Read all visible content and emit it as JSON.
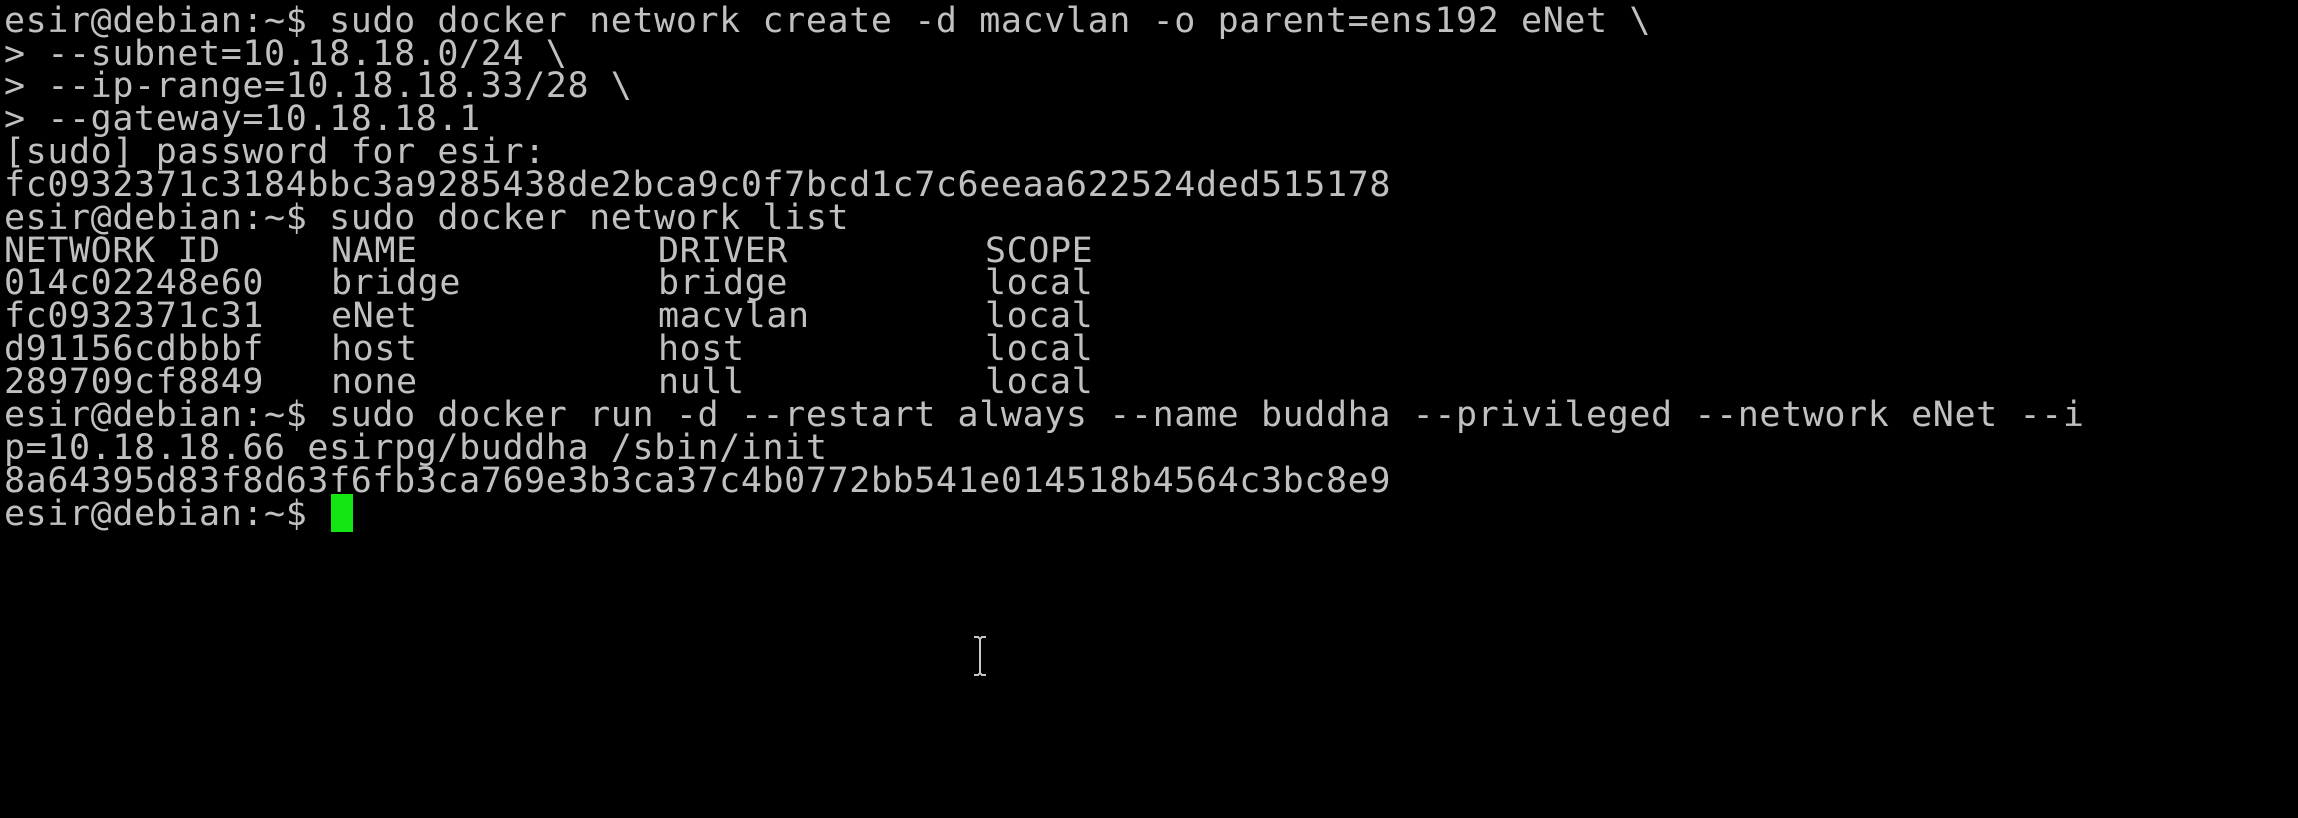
{
  "terminal": {
    "background_color": "#000000",
    "text_color": "#c0c0c0",
    "cursor_color": "#13e613",
    "lines": {
      "l0": "esir@debian:~$ sudo docker network create -d macvlan -o parent=ens192 eNet \\",
      "l1": "> --subnet=10.18.18.0/24 \\",
      "l2": "> --ip-range=10.18.18.33/28 \\",
      "l3": "> --gateway=10.18.18.1",
      "l4": "[sudo] password for esir:",
      "l5": "fc0932371c3184bbc3a9285438de2bca9c0f7bcd1c7c6eeaa622524ded515178",
      "l6": "esir@debian:~$ sudo docker network list",
      "l12": "esir@debian:~$ sudo docker run -d --restart always --name buddha --privileged --network eNet --i",
      "l13": "p=10.18.18.66 esirpg/buddha /sbin/init",
      "l14": "8a64395d83f8d63f6fb3ca769e3b3ca37c4b0772bb541e014518b4564c3bc8e9",
      "l15": "esir@debian:~$ "
    },
    "network_table": {
      "headers": [
        "NETWORK ID",
        "NAME",
        "DRIVER",
        "SCOPE"
      ],
      "rows": [
        [
          "014c02248e60",
          "bridge",
          "bridge",
          "local"
        ],
        [
          "fc0932371c31",
          "eNet",
          "macvlan",
          "local"
        ],
        [
          "d91156cdbbbf",
          "host",
          "host",
          "local"
        ],
        [
          "289709cf8849",
          "none",
          "null",
          "local"
        ]
      ]
    },
    "icons": {
      "cursor": "block-cursor",
      "mouse_pointer": "ibeam-icon"
    }
  }
}
